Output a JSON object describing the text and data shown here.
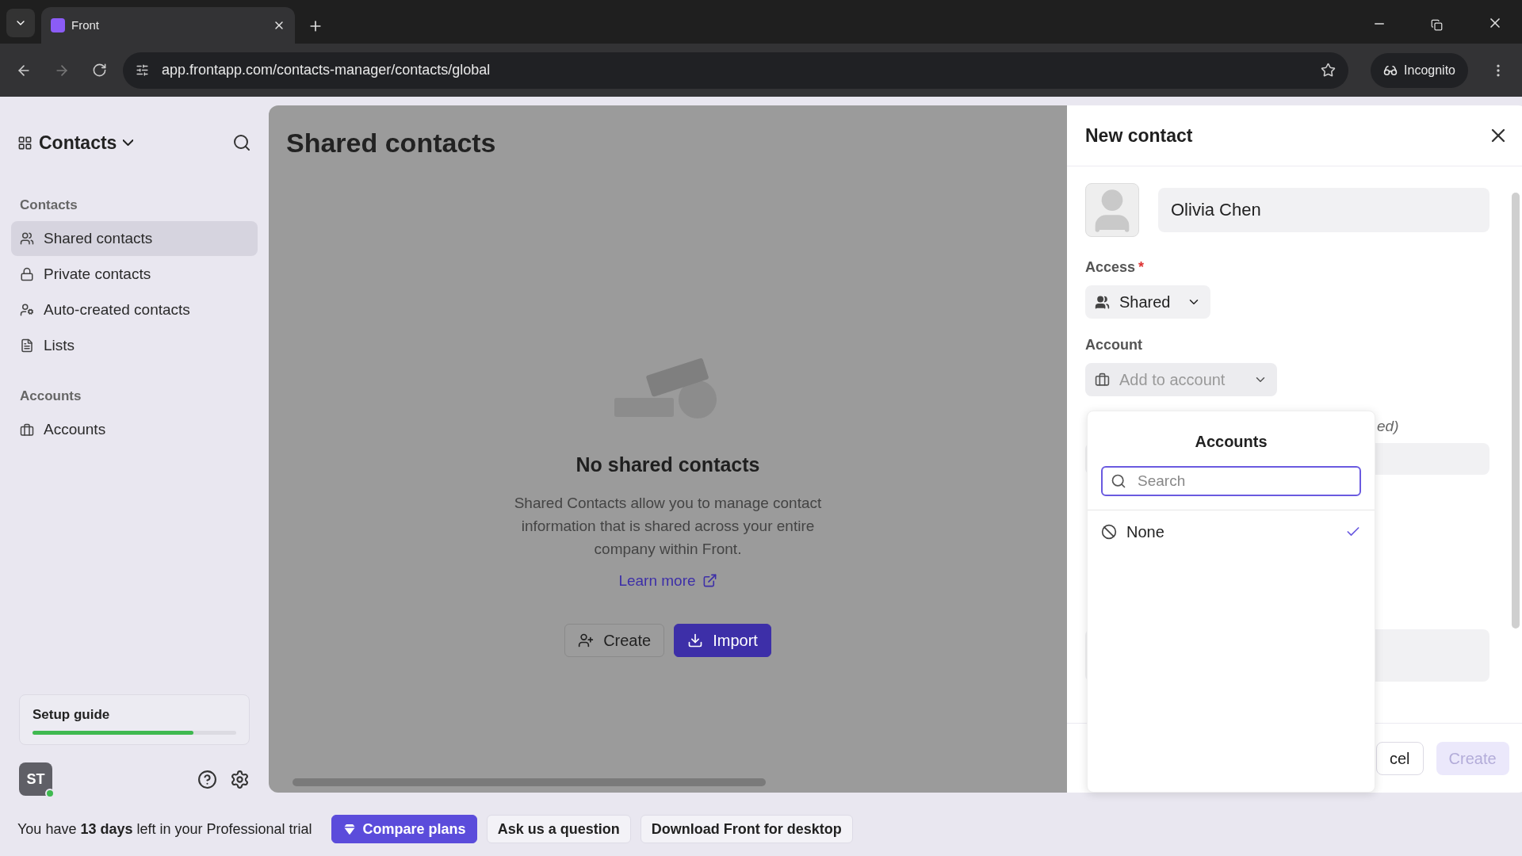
{
  "browser": {
    "tab_title": "Front",
    "url": "app.frontapp.com/contacts-manager/contacts/global",
    "profile": "Incognito"
  },
  "sidebar": {
    "title": "Contacts",
    "sections": [
      {
        "heading": "Contacts",
        "items": [
          {
            "label": "Shared contacts",
            "selected": true
          },
          {
            "label": "Private contacts",
            "selected": false
          },
          {
            "label": "Auto-created contacts",
            "selected": false
          },
          {
            "label": "Lists",
            "selected": false
          }
        ]
      },
      {
        "heading": "Accounts",
        "items": [
          {
            "label": "Accounts",
            "selected": false
          }
        ]
      }
    ],
    "setup_guide": {
      "label": "Setup guide",
      "level": 0.79
    },
    "user": {
      "initials": "ST",
      "online": true
    }
  },
  "main": {
    "title": "Shared contacts",
    "empty_state": {
      "heading": "No shared contacts",
      "description": "Shared Contacts allow you to manage contact information that is shared across your entire company within Front.",
      "link": "Learn more"
    },
    "buttons": [
      {
        "label": "Create",
        "kind": "secondary"
      },
      {
        "label": "Import",
        "kind": "primary"
      }
    ]
  },
  "drawer": {
    "title": "New contact",
    "name_value": "Olivia Chen",
    "access": {
      "label": "Access",
      "required_mark": "*",
      "value": "Shared"
    },
    "account": {
      "label": "Account",
      "placeholder": "Add to account"
    },
    "field_label_fragment": "ed)",
    "footer_buttons": [
      {
        "label": "cel",
        "disabled": false
      },
      {
        "label": "Create",
        "disabled": true
      }
    ]
  },
  "popover": {
    "title": "Accounts",
    "search": {
      "placeholder": "Search"
    },
    "options": [
      {
        "label": "None",
        "selected": true
      }
    ]
  },
  "trial_bar": {
    "message": "You have **13 days** left in your Professional trial",
    "buttons": [
      {
        "label": "Compare plans",
        "kind": "primary"
      },
      {
        "label": "Ask us a question",
        "kind": "secondary"
      },
      {
        "label": "Download Front for desktop",
        "kind": "secondary"
      }
    ]
  }
}
